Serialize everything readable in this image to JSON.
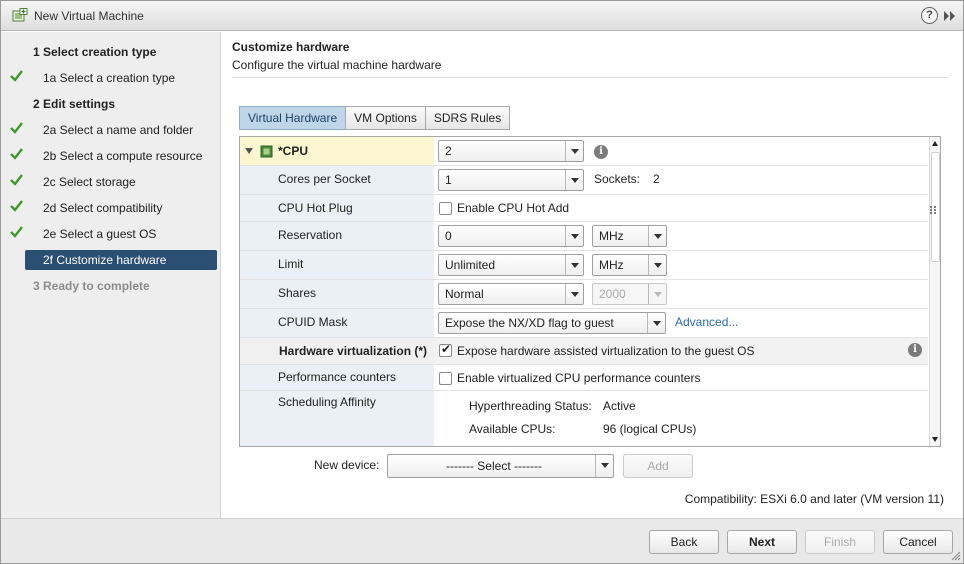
{
  "window": {
    "title": "New Virtual Machine",
    "help_icon": "?",
    "app_icon": "vm-wizard-icon",
    "accent_color": "#2b4e73"
  },
  "steps": [
    {
      "label": "1  Select creation type",
      "state": "header"
    },
    {
      "label": "1a  Select a creation type",
      "state": "done"
    },
    {
      "label": "2  Edit settings",
      "state": "header"
    },
    {
      "label": "2a  Select a name and folder",
      "state": "done"
    },
    {
      "label": "2b  Select a compute resource",
      "state": "done"
    },
    {
      "label": "2c  Select storage",
      "state": "done"
    },
    {
      "label": "2d  Select compatibility",
      "state": "done"
    },
    {
      "label": "2e  Select a guest OS",
      "state": "done"
    },
    {
      "label": "2f  Customize hardware",
      "state": "active"
    },
    {
      "label": "3  Ready to complete",
      "state": "disabled"
    }
  ],
  "content": {
    "title": "Customize hardware",
    "subtitle": "Configure the virtual machine hardware"
  },
  "tabs": [
    {
      "label": "Virtual Hardware",
      "active": true
    },
    {
      "label": "VM Options",
      "active": false
    },
    {
      "label": "SDRS Rules",
      "active": false
    }
  ],
  "hardware": {
    "cpu": {
      "label": "*CPU",
      "value": "2"
    },
    "cores_per_socket": {
      "label": "Cores per Socket",
      "value": "1",
      "sockets_label": "Sockets:",
      "sockets_value": "2"
    },
    "cpu_hot_plug": {
      "label": "CPU Hot Plug",
      "checkbox_label": "Enable CPU Hot Add",
      "checked": false
    },
    "reservation": {
      "label": "Reservation",
      "value": "0",
      "unit": "MHz"
    },
    "limit": {
      "label": "Limit",
      "value": "Unlimited",
      "unit": "MHz"
    },
    "shares": {
      "label": "Shares",
      "value": "Normal",
      "amount": "2000"
    },
    "cpuid_mask": {
      "label": "CPUID Mask",
      "value": "Expose the NX/XD flag to guest",
      "advanced_link": "Advanced..."
    },
    "hw_virt": {
      "label": "Hardware virtualization (*)",
      "checkbox_label": "Expose hardware assisted virtualization to the guest OS",
      "checked": true
    },
    "perf_counters": {
      "label": "Performance counters",
      "checkbox_label": "Enable virtualized CPU performance counters",
      "checked": false
    },
    "sched_affinity": {
      "label": "Scheduling Affinity",
      "ht_label": "Hyperthreading Status:",
      "ht_value": "Active",
      "cpus_label": "Available CPUs:",
      "cpus_value": "96 (logical CPUs)"
    }
  },
  "new_device": {
    "label": "New device:",
    "select_value": "------- Select -------",
    "add_label": "Add"
  },
  "compatibility": "Compatibility: ESXi 6.0 and later (VM version 11)",
  "footer": {
    "back": "Back",
    "next": "Next",
    "finish": "Finish",
    "cancel": "Cancel"
  }
}
